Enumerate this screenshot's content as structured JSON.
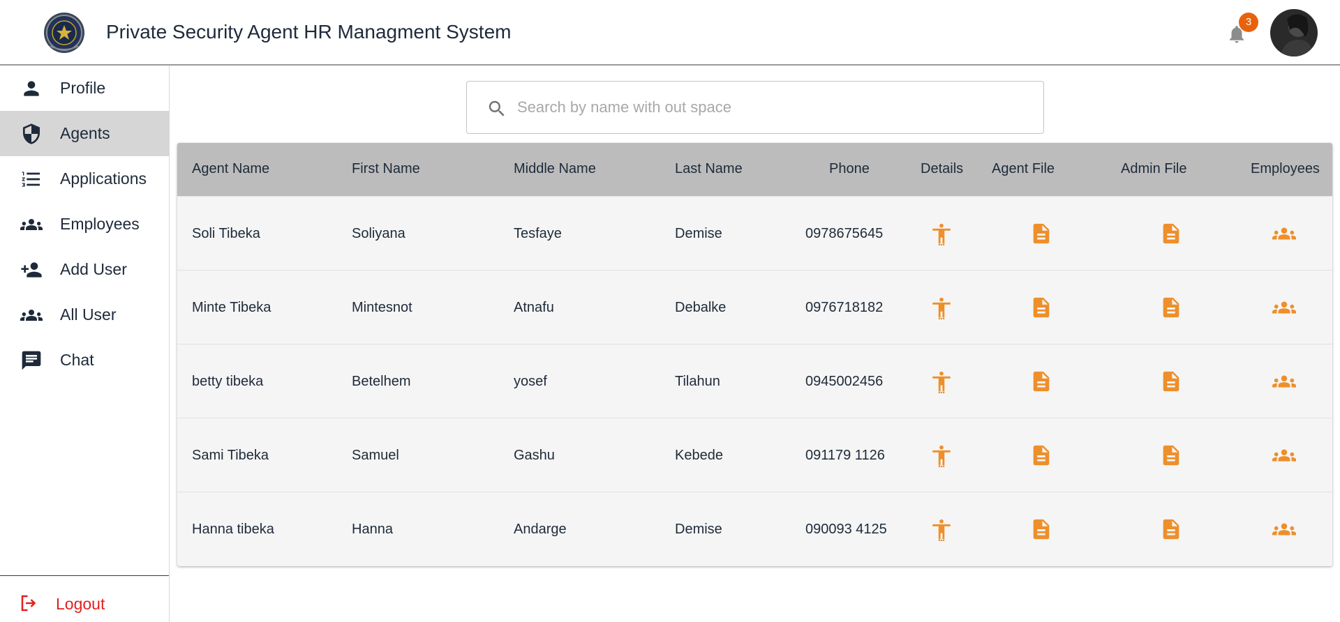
{
  "app": {
    "title": "Private Security Agent HR Managment System",
    "notification_count": "3",
    "accent_color": "#ee8f2b",
    "nav_text_color": "#1e2a3a"
  },
  "sidebar": {
    "items": [
      {
        "label": "Profile",
        "icon": "person-icon",
        "active": false
      },
      {
        "label": "Agents",
        "icon": "shield-icon",
        "active": true
      },
      {
        "label": "Applications",
        "icon": "list-icon",
        "active": false
      },
      {
        "label": "Employees",
        "icon": "groups-icon",
        "active": false
      },
      {
        "label": "Add User",
        "icon": "person-add-icon",
        "active": false
      },
      {
        "label": "All User",
        "icon": "groups-icon",
        "active": false
      },
      {
        "label": "Chat",
        "icon": "chat-icon",
        "active": false
      }
    ],
    "logout_label": "Logout"
  },
  "search": {
    "placeholder": "Search by name with out space",
    "value": ""
  },
  "table": {
    "headers": {
      "agent_name": "Agent Name",
      "first_name": "First Name",
      "middle_name": "Middle Name",
      "last_name": "Last Name",
      "phone": "Phone",
      "details": "Details",
      "agent_file": "Agent File",
      "admin_file": "Admin File",
      "employees": "Employees"
    },
    "rows": [
      {
        "agent_name": "Soli Tibeka",
        "first_name": "Soliyana",
        "middle_name": "Tesfaye",
        "last_name": "Demise",
        "phone": "0978675645"
      },
      {
        "agent_name": "Minte Tibeka",
        "first_name": "Mintesnot",
        "middle_name": "Atnafu",
        "last_name": "Debalke",
        "phone": "0976718182"
      },
      {
        "agent_name": "betty tibeka",
        "first_name": "Betelhem",
        "middle_name": "yosef",
        "last_name": "Tilahun",
        "phone": "0945002456"
      },
      {
        "agent_name": "Sami Tibeka",
        "first_name": "Samuel",
        "middle_name": "Gashu",
        "last_name": "Kebede",
        "phone": "091179 1126"
      },
      {
        "agent_name": "Hanna tibeka",
        "first_name": "Hanna",
        "middle_name": "Andarge",
        "last_name": "Demise",
        "phone": "090093 4125"
      }
    ]
  }
}
